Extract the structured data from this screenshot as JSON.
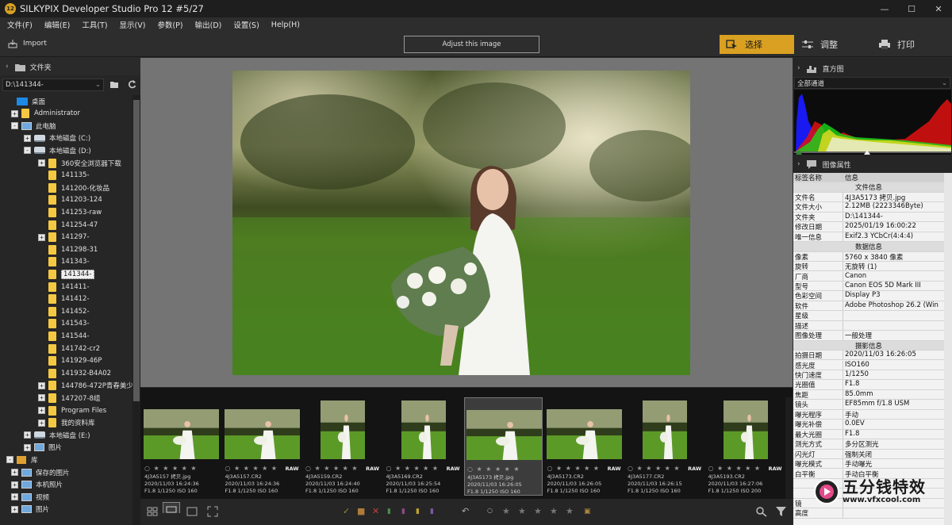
{
  "window": {
    "title": "SILKYPIX Developer Studio Pro 12   #5/27",
    "logo_text": "12",
    "controls": [
      "—",
      "☐",
      "✕"
    ]
  },
  "menu": [
    "文件(F)",
    "编辑(E)",
    "工具(T)",
    "显示(V)",
    "参数(P)",
    "输出(D)",
    "设置(S)",
    "Help(H)"
  ],
  "toolbar": {
    "import_label": "Import",
    "adjust_label": "Adjust this image",
    "tabs": {
      "select": "选择",
      "adjust": "调整",
      "print": "打印"
    },
    "accent": "#d9a021"
  },
  "folder_panel": {
    "title": "文件夹",
    "path": "D:\\141344-",
    "tree": [
      {
        "label": "桌面",
        "icon": "desktop",
        "level": 0,
        "toggle": ""
      },
      {
        "label": "Administrator",
        "icon": "user-folder",
        "level": 1,
        "toggle": "+"
      },
      {
        "label": "此电脑",
        "icon": "pc",
        "level": 1,
        "toggle": "-"
      },
      {
        "label": "本地磁盘 (C:)",
        "icon": "drive",
        "level": 2,
        "toggle": "+"
      },
      {
        "label": "本地磁盘 (D:)",
        "icon": "drive",
        "level": 2,
        "toggle": "-"
      },
      {
        "label": "360安全浏览器下载",
        "icon": "folder",
        "level": 3,
        "toggle": "+"
      },
      {
        "label": "141135-",
        "icon": "folder",
        "level": 3,
        "toggle": ""
      },
      {
        "label": "141200-化妆品",
        "icon": "folder",
        "level": 3,
        "toggle": ""
      },
      {
        "label": "141203-124",
        "icon": "folder",
        "level": 3,
        "toggle": ""
      },
      {
        "label": "141253-raw",
        "icon": "folder",
        "level": 3,
        "toggle": ""
      },
      {
        "label": "141254-47",
        "icon": "folder",
        "level": 3,
        "toggle": ""
      },
      {
        "label": "141297-",
        "icon": "folder",
        "level": 3,
        "toggle": "+"
      },
      {
        "label": "141298-31",
        "icon": "folder",
        "level": 3,
        "toggle": ""
      },
      {
        "label": "141343-",
        "icon": "folder",
        "level": 3,
        "toggle": ""
      },
      {
        "label": "141344-",
        "icon": "folder",
        "level": 3,
        "toggle": "",
        "selected": true
      },
      {
        "label": "141411-",
        "icon": "folder",
        "level": 3,
        "toggle": ""
      },
      {
        "label": "141412-",
        "icon": "folder",
        "level": 3,
        "toggle": ""
      },
      {
        "label": "141452-",
        "icon": "folder",
        "level": 3,
        "toggle": ""
      },
      {
        "label": "141543-",
        "icon": "folder",
        "level": 3,
        "toggle": ""
      },
      {
        "label": "141544-",
        "icon": "folder",
        "level": 3,
        "toggle": ""
      },
      {
        "label": "141742-cr2",
        "icon": "folder",
        "level": 3,
        "toggle": ""
      },
      {
        "label": "141929-46P",
        "icon": "folder",
        "level": 3,
        "toggle": ""
      },
      {
        "label": "141932-B4A02",
        "icon": "folder",
        "level": 3,
        "toggle": ""
      },
      {
        "label": "144786-472P青春美少",
        "icon": "folder",
        "level": 3,
        "toggle": "+"
      },
      {
        "label": "147207-8组",
        "icon": "folder",
        "level": 3,
        "toggle": "+"
      },
      {
        "label": "Program Files",
        "icon": "folder",
        "level": 3,
        "toggle": "+"
      },
      {
        "label": "我的资料库",
        "icon": "folder",
        "level": 3,
        "toggle": "+"
      },
      {
        "label": "本地磁盘 (E:)",
        "icon": "drive",
        "level": 2,
        "toggle": "+"
      },
      {
        "label": "图片",
        "icon": "pc",
        "level": 2,
        "toggle": "+"
      },
      {
        "label": "库",
        "icon": "library",
        "level": 0,
        "toggle": "-"
      },
      {
        "label": "保存的图片",
        "icon": "pc",
        "level": 1,
        "toggle": "+"
      },
      {
        "label": "本机照片",
        "icon": "pc",
        "level": 1,
        "toggle": "+"
      },
      {
        "label": "视频",
        "icon": "pc",
        "level": 1,
        "toggle": "+"
      },
      {
        "label": "图片",
        "icon": "pc",
        "level": 1,
        "toggle": "+"
      }
    ]
  },
  "filmstrip": [
    {
      "name": "4J3A5157 拷贝.jpg",
      "date": "2020/11/03 16:24:36",
      "exif": "F1.8 1/1250 ISO 160",
      "raw": false,
      "orient": "landscape"
    },
    {
      "name": "4J3A5157.CR2",
      "date": "2020/11/03 16:24:36",
      "exif": "F1.8 1/1250 ISO 160",
      "raw": true,
      "orient": "landscape"
    },
    {
      "name": "4J3A5159.CR2",
      "date": "2020/11/03 16:24:40",
      "exif": "F1.8 1/1250 ISO 160",
      "raw": true,
      "orient": "portrait"
    },
    {
      "name": "4J3A5169.CR2",
      "date": "2020/11/03 16:25:54",
      "exif": "F1.8 1/1250 ISO 160",
      "raw": true,
      "orient": "portrait"
    },
    {
      "name": "4J3A5173 拷贝.jpg",
      "date": "2020/11/03 16:26:05",
      "exif": "F1.8 1/1250 ISO 160",
      "raw": false,
      "orient": "landscape",
      "selected": true
    },
    {
      "name": "4J3A5173.CR2",
      "date": "2020/11/03 16:26:05",
      "exif": "F1.8 1/1250 ISO 160",
      "raw": true,
      "orient": "landscape"
    },
    {
      "name": "4J3A5177.CR2",
      "date": "2020/11/03 16:26:15",
      "exif": "F1.8 1/1250 ISO 160",
      "raw": true,
      "orient": "portrait"
    },
    {
      "name": "4J3A5193.CR2",
      "date": "2020/11/03 16:27:06",
      "exif": "F1.8 1/1250 ISO 200",
      "raw": true,
      "orient": "portrait"
    }
  ],
  "raw_badge": "RAW",
  "histogram": {
    "title": "直方图",
    "channel": "全部通道"
  },
  "properties": {
    "title": "图像属性",
    "header": {
      "key": "标签名称",
      "value": "信息"
    },
    "rows": [
      {
        "section": "文件信息"
      },
      {
        "k": "文件名",
        "v": "4J3A5173 拷贝.jpg"
      },
      {
        "k": "文件大小",
        "v": "2.12MB (2223346Byte)"
      },
      {
        "k": "文件夹",
        "v": "D:\\141344-"
      },
      {
        "k": "修改日期",
        "v": "2025/01/19 16:00:22"
      },
      {
        "k": "唯一信息",
        "v": "Exif2.3 YCbCr(4:4:4)"
      },
      {
        "section": "数据信息"
      },
      {
        "k": "像素",
        "v": "5760 x 3840 像素"
      },
      {
        "k": "旋转",
        "v": "无旋转 (1)"
      },
      {
        "k": "厂商",
        "v": "Canon"
      },
      {
        "k": "型号",
        "v": "Canon EOS 5D Mark III"
      },
      {
        "k": "色彩空间",
        "v": "Display P3"
      },
      {
        "k": "软件",
        "v": "Adobe Photoshop 26.2 (Win"
      },
      {
        "k": "星级",
        "v": ""
      },
      {
        "k": "描述",
        "v": ""
      },
      {
        "k": "图像处理",
        "v": "一般处理"
      },
      {
        "section": "摄影信息"
      },
      {
        "k": "拍摄日期",
        "v": "2020/11/03 16:26:05"
      },
      {
        "k": "感光度",
        "v": "ISO160"
      },
      {
        "k": "快门速度",
        "v": "1/1250"
      },
      {
        "k": "光圈值",
        "v": "F1.8"
      },
      {
        "k": "焦距",
        "v": "85.0mm"
      },
      {
        "k": "镜头",
        "v": "EF85mm f/1.8 USM"
      },
      {
        "k": "曝光程序",
        "v": "手动"
      },
      {
        "k": "曝光补偿",
        "v": "0.0EV"
      },
      {
        "k": "最大光圈",
        "v": "F1.8"
      },
      {
        "k": "测光方式",
        "v": "多分区测光"
      },
      {
        "k": "闪光灯",
        "v": "强制关闭"
      },
      {
        "k": "曝光模式",
        "v": "手动曝光"
      },
      {
        "k": "白平衡",
        "v": "手动白平衡"
      },
      {
        "k": "",
        "v": ""
      },
      {
        "k": "",
        "v": ""
      },
      {
        "k": "镜",
        "v": ""
      },
      {
        "k": "高度",
        "v": ""
      }
    ]
  },
  "watermark": {
    "cn": "五分钱特效",
    "url": "www.vfxcool.com"
  }
}
